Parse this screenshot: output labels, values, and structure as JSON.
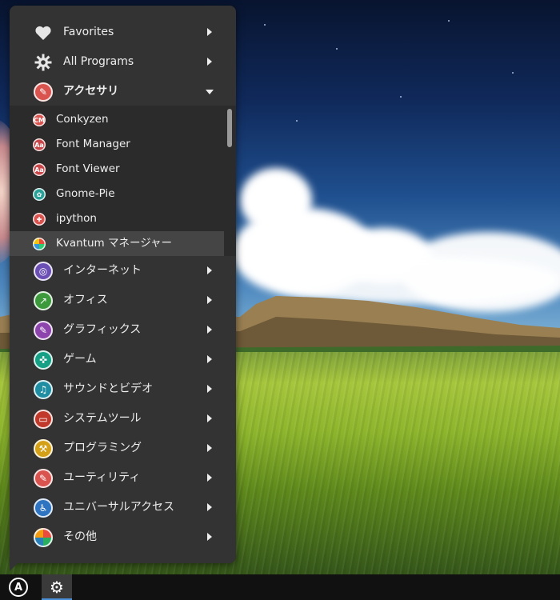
{
  "menu": {
    "items": [
      {
        "label": "Favorites",
        "icon": "heart-icon",
        "color": "#e6e6e6",
        "expanded": false
      },
      {
        "label": "All Programs",
        "icon": "gear-icon",
        "color": "#e6e6e6",
        "expanded": false
      },
      {
        "label": "アクセサリ",
        "icon": "accessories-icon",
        "color": "#d9534f",
        "expanded": true
      }
    ],
    "accessories": [
      {
        "label": "Conkyzen",
        "icon": "conkyzen-icon",
        "badge": "CM",
        "color": "#d9534f"
      },
      {
        "label": "Font Manager",
        "icon": "font-manager-icon",
        "badge": "Aa",
        "color": "#c7474a"
      },
      {
        "label": "Font Viewer",
        "icon": "font-viewer-icon",
        "badge": "Aa",
        "color": "#c7474a"
      },
      {
        "label": "Gnome-Pie",
        "icon": "gnome-pie-icon",
        "badge": "✿",
        "color": "#2aa198"
      },
      {
        "label": "ipython",
        "icon": "ipython-icon",
        "badge": "✚",
        "color": "#d9534f"
      },
      {
        "label": "Kvantum マネージャー",
        "icon": "kvantum-icon",
        "badge": "●",
        "color": "#3a7bd5"
      }
    ],
    "categories": [
      {
        "label": "インターネット",
        "icon": "internet-icon",
        "color": "#6c4fb5"
      },
      {
        "label": "オフィス",
        "icon": "office-icon",
        "color": "#3c9a3c"
      },
      {
        "label": "グラフィックス",
        "icon": "graphics-icon",
        "color": "#8e44ad"
      },
      {
        "label": "ゲーム",
        "icon": "games-icon",
        "color": "#16a085"
      },
      {
        "label": "サウンドとビデオ",
        "icon": "sound-video-icon",
        "color": "#1f8ea3"
      },
      {
        "label": "システムツール",
        "icon": "system-tools-icon",
        "color": "#c0392b"
      },
      {
        "label": "プログラミング",
        "icon": "programming-icon",
        "color": "#d4a017"
      },
      {
        "label": "ユーティリティ",
        "icon": "utilities-icon",
        "color": "#d9534f"
      },
      {
        "label": "ユニバーサルアクセス",
        "icon": "universal-access-icon",
        "color": "#2f74c0"
      },
      {
        "label": "その他",
        "icon": "other-icon",
        "color": "#e67e22"
      }
    ]
  },
  "taskbar": {
    "menu_button_glyph": "A",
    "app_icon": "gear-icon",
    "accent": "#4a90d9"
  }
}
